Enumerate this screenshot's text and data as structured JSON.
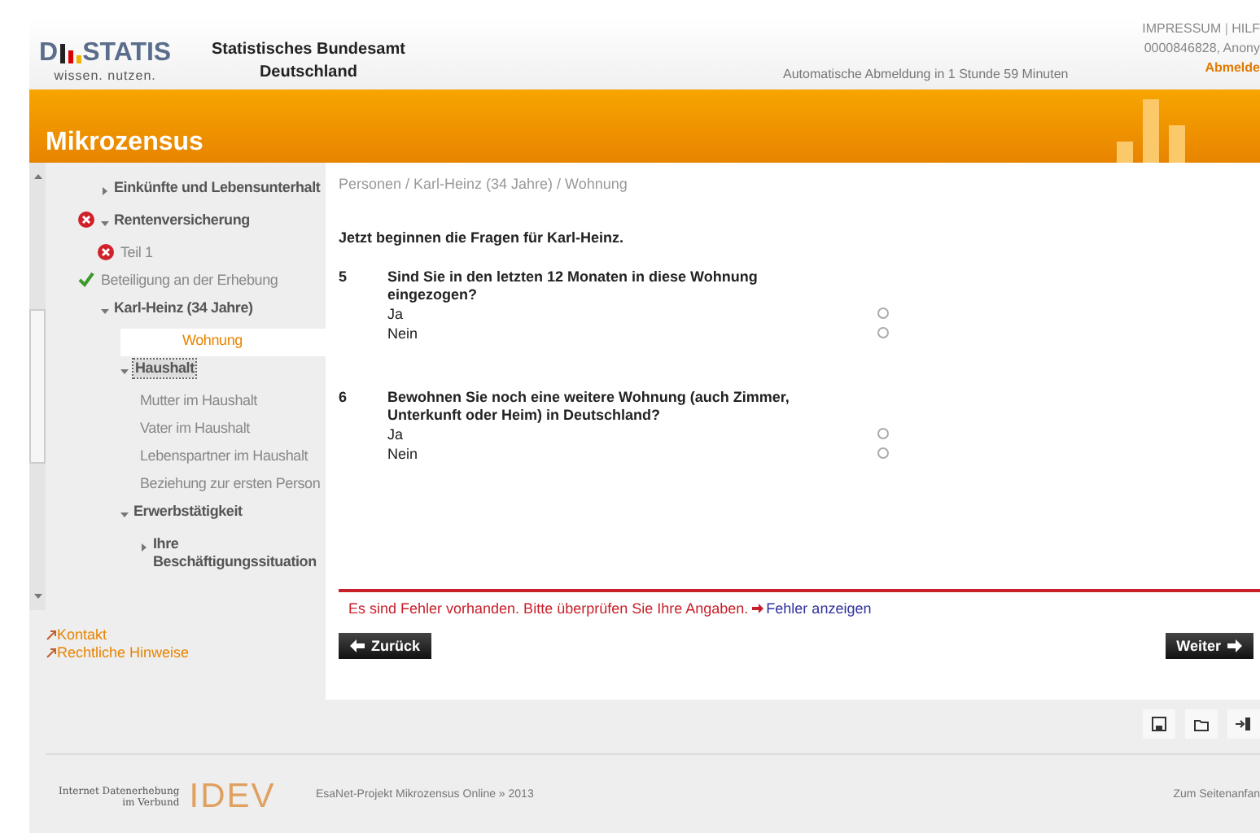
{
  "header": {
    "logo_left": "D",
    "logo_right": "STATIS",
    "slogan": "wissen. nutzen.",
    "org_line1": "Statistisches Bundesamt",
    "org_line2": "Deutschland",
    "auto_logout": "Automatische Abmeldung in 1 Stunde 59 Minuten",
    "top_links": [
      "IMPRESSUM",
      "HILF"
    ],
    "top_links_separator": "|",
    "user": "0000846828, Anony",
    "logout": "Abmelde"
  },
  "banner": {
    "title": "Mikrozensus"
  },
  "sidebar": {
    "items": [
      {
        "label": "Einkünfte und Lebensunterhalt",
        "expanded": false,
        "selected": false
      },
      {
        "label": "Rentenversicherung",
        "expanded": true,
        "error": true,
        "selected": false,
        "children": [
          {
            "label": "Teil 1",
            "error": true,
            "selected": false
          }
        ]
      },
      {
        "label": "Beteiligung an der Erhebung",
        "done": true,
        "selected": false
      },
      {
        "label": "Karl-Heinz (34 Jahre)",
        "expanded": true,
        "selected": false,
        "children": [
          {
            "label": "Wohnung",
            "selected": true
          },
          {
            "label": "Haushalt",
            "expanded": true,
            "selected": false,
            "focused": true,
            "children": [
              {
                "label": "Mutter im Haushalt",
                "selected": false
              },
              {
                "label": "Vater im Haushalt",
                "selected": false
              },
              {
                "label": "Lebenspartner im Haushalt",
                "selected": false
              },
              {
                "label": "Beziehung zur ersten Person",
                "selected": false
              }
            ]
          },
          {
            "label": "Erwerbstätigkeit",
            "expanded": true,
            "selected": false,
            "children": [
              {
                "label": "Ihre Beschäftigungssituation",
                "expanded": false,
                "selected": false
              }
            ]
          }
        ]
      }
    ],
    "links": [
      "Kontakt",
      "Rechtliche Hinweise"
    ]
  },
  "main": {
    "breadcrumb": "Personen / Karl-Heinz (34 Jahre) / Wohnung",
    "intro": "Jetzt beginnen die Fragen für Karl-Heinz.",
    "questions": [
      {
        "number": "5",
        "text": "Sind Sie in den letzten 12 Monaten in diese Wohnung eingezogen?",
        "options": [
          {
            "label": "Ja",
            "selected": false
          },
          {
            "label": "Nein",
            "selected": false
          }
        ]
      },
      {
        "number": "6",
        "text": "Bewohnen Sie noch eine weitere Wohnung (auch Zimmer, Unterkunft oder Heim) in Deutschland?",
        "options": [
          {
            "label": "Ja",
            "selected": false
          },
          {
            "label": "Nein",
            "selected": false
          }
        ]
      }
    ],
    "error": "Es sind Fehler vorhanden. Bitte überprüfen Sie Ihre Angaben.",
    "error_link": "Fehler anzeigen",
    "back": "Zurück",
    "next": "Weiter"
  },
  "footer": {
    "idev_line1": "Internet Datenerhebung",
    "idev_line2": "im Verbund",
    "idev_logo": "IDEV",
    "project": "EsaNet-Projekt Mikrozensus Online » 2013",
    "top_link": "Zum Seitenanfan"
  }
}
